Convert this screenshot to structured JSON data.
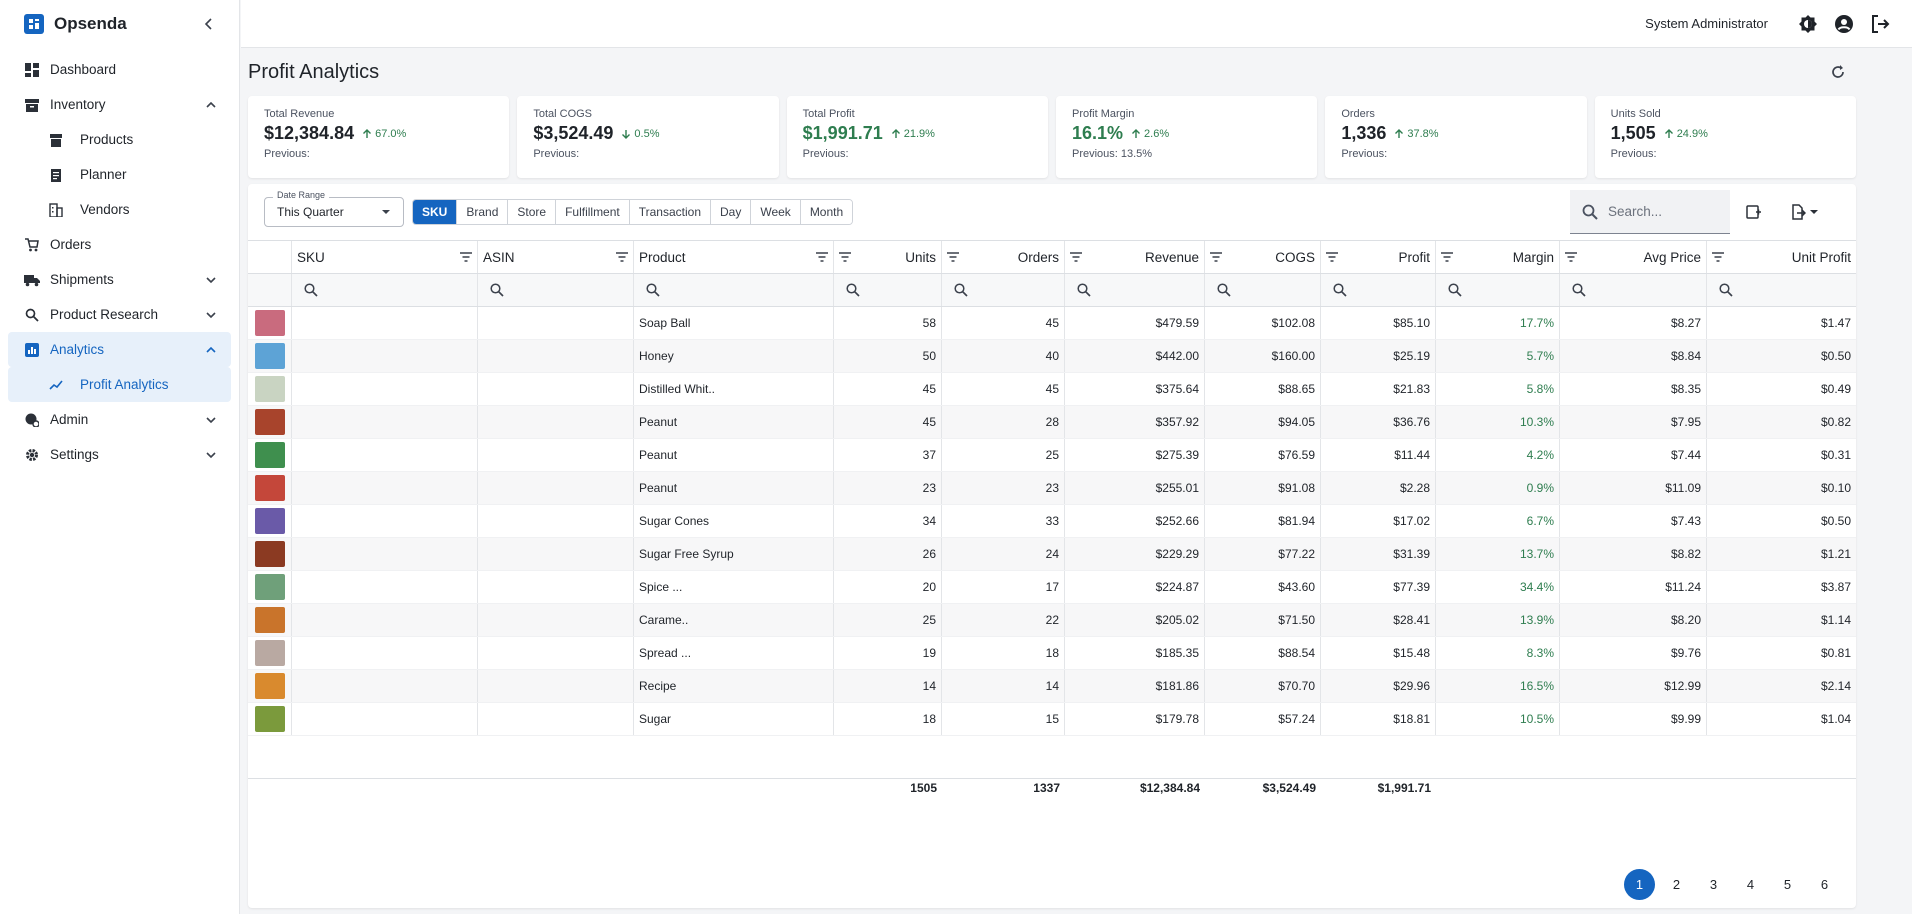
{
  "app": {
    "name": "Opsenda"
  },
  "sidebar": {
    "items": [
      {
        "label": "Dashboard",
        "icon": "dashboard-icon"
      },
      {
        "label": "Inventory",
        "icon": "inventory-icon",
        "expanded": true
      },
      {
        "label": "Products",
        "icon": "products-icon"
      },
      {
        "label": "Planner",
        "icon": "planner-icon"
      },
      {
        "label": "Vendors",
        "icon": "vendors-icon"
      },
      {
        "label": "Orders",
        "icon": "cart-icon"
      },
      {
        "label": "Shipments",
        "icon": "truck-icon"
      },
      {
        "label": "Product Research",
        "icon": "search-icon"
      },
      {
        "label": "Analytics",
        "icon": "analytics-icon",
        "expanded": true
      },
      {
        "label": "Profit Analytics",
        "icon": "trending-icon",
        "active": true
      },
      {
        "label": "Admin",
        "icon": "admin-icon"
      },
      {
        "label": "Settings",
        "icon": "gear-icon"
      }
    ]
  },
  "topbar": {
    "user": "System Administrator"
  },
  "page": {
    "title": "Profit Analytics"
  },
  "kpis": [
    {
      "label": "Total Revenue",
      "value": "$12,384.84",
      "delta": "67.0%",
      "direction": "up",
      "previous": "Previous:"
    },
    {
      "label": "Total COGS",
      "value": "$3,524.49",
      "delta": "0.5%",
      "direction": "down",
      "previous": "Previous:"
    },
    {
      "label": "Total Profit",
      "value": "$1,991.71",
      "delta": "21.9%",
      "direction": "up",
      "previous": "Previous:"
    },
    {
      "label": "Profit Margin",
      "value": "16.1%",
      "delta": "2.6%",
      "direction": "up",
      "previous": "Previous: 13.5%"
    },
    {
      "label": "Orders",
      "value": "1,336",
      "delta": "37.8%",
      "direction": "up",
      "previous": "Previous:"
    },
    {
      "label": "Units Sold",
      "value": "1,505",
      "delta": "24.9%",
      "direction": "up",
      "previous": "Previous:"
    }
  ],
  "toolbar": {
    "date_range_label": "Date Range",
    "date_range_value": "This Quarter",
    "groupings": [
      "SKU",
      "Brand",
      "Store",
      "Fulfillment",
      "Transaction",
      "Day",
      "Week",
      "Month"
    ],
    "active_grouping": "SKU",
    "search_placeholder": "Search..."
  },
  "table": {
    "columns": [
      "SKU",
      "ASIN",
      "Product",
      "Units",
      "Orders",
      "Revenue",
      "COGS",
      "Profit",
      "Margin",
      "Avg Price",
      "Unit Profit"
    ],
    "rows": [
      {
        "thumb": "#c96b7e",
        "sku": "",
        "asin": "",
        "product": "Soap Ball",
        "units": "58",
        "orders": "45",
        "revenue": "$479.59",
        "cogs": "$102.08",
        "profit": "$85.10",
        "margin": "17.7%",
        "avg_price": "$8.27",
        "unit_profit": "$1.47"
      },
      {
        "thumb": "#5da3d6",
        "sku": "",
        "asin": "",
        "product": "Honey",
        "units": "50",
        "orders": "40",
        "revenue": "$442.00",
        "cogs": "$160.00",
        "profit": "$25.19",
        "margin": "5.7%",
        "avg_price": "$8.84",
        "unit_profit": "$0.50"
      },
      {
        "thumb": "#c9d4c2",
        "sku": "",
        "asin": "",
        "product": "Distilled Whit..",
        "units": "45",
        "orders": "45",
        "revenue": "$375.64",
        "cogs": "$88.65",
        "profit": "$21.83",
        "margin": "5.8%",
        "avg_price": "$8.35",
        "unit_profit": "$0.49"
      },
      {
        "thumb": "#a8442c",
        "sku": "",
        "asin": "",
        "product": "Peanut",
        "units": "45",
        "orders": "28",
        "revenue": "$357.92",
        "cogs": "$94.05",
        "profit": "$36.76",
        "margin": "10.3%",
        "avg_price": "$7.95",
        "unit_profit": "$0.82"
      },
      {
        "thumb": "#3f8f4e",
        "sku": "",
        "asin": "",
        "product": "Peanut",
        "units": "37",
        "orders": "25",
        "revenue": "$275.39",
        "cogs": "$76.59",
        "profit": "$11.44",
        "margin": "4.2%",
        "avg_price": "$7.44",
        "unit_profit": "$0.31"
      },
      {
        "thumb": "#c4473a",
        "sku": "",
        "asin": "",
        "product": "Peanut",
        "units": "23",
        "orders": "23",
        "revenue": "$255.01",
        "cogs": "$91.08",
        "profit": "$2.28",
        "margin": "0.9%",
        "avg_price": "$11.09",
        "unit_profit": "$0.10"
      },
      {
        "thumb": "#6a5aa8",
        "sku": "",
        "asin": "",
        "product": "Sugar Cones",
        "units": "34",
        "orders": "33",
        "revenue": "$252.66",
        "cogs": "$81.94",
        "profit": "$17.02",
        "margin": "6.7%",
        "avg_price": "$7.43",
        "unit_profit": "$0.50"
      },
      {
        "thumb": "#8b3a22",
        "sku": "",
        "asin": "",
        "product": "Sugar Free Syrup",
        "units": "26",
        "orders": "24",
        "revenue": "$229.29",
        "cogs": "$77.22",
        "profit": "$31.39",
        "margin": "13.7%",
        "avg_price": "$8.82",
        "unit_profit": "$1.21"
      },
      {
        "thumb": "#6fa07a",
        "sku": "",
        "asin": "",
        "product": "Spice ...",
        "units": "20",
        "orders": "17",
        "revenue": "$224.87",
        "cogs": "$43.60",
        "profit": "$77.39",
        "margin": "34.4%",
        "avg_price": "$11.24",
        "unit_profit": "$3.87"
      },
      {
        "thumb": "#c9742b",
        "sku": "",
        "asin": "",
        "product": "Carame..",
        "units": "25",
        "orders": "22",
        "revenue": "$205.02",
        "cogs": "$71.50",
        "profit": "$28.41",
        "margin": "13.9%",
        "avg_price": "$8.20",
        "unit_profit": "$1.14"
      },
      {
        "thumb": "#b9a9a2",
        "sku": "",
        "asin": "",
        "product": "Spread ...",
        "units": "19",
        "orders": "18",
        "revenue": "$185.35",
        "cogs": "$88.54",
        "profit": "$15.48",
        "margin": "8.3%",
        "avg_price": "$9.76",
        "unit_profit": "$0.81"
      },
      {
        "thumb": "#d98a2e",
        "sku": "",
        "asin": "",
        "product": "Recipe",
        "units": "14",
        "orders": "14",
        "revenue": "$181.86",
        "cogs": "$70.70",
        "profit": "$29.96",
        "margin": "16.5%",
        "avg_price": "$12.99",
        "unit_profit": "$2.14"
      },
      {
        "thumb": "#7b9a3c",
        "sku": "",
        "asin": "",
        "product": "Sugar",
        "units": "18",
        "orders": "15",
        "revenue": "$179.78",
        "cogs": "$57.24",
        "profit": "$18.81",
        "margin": "10.5%",
        "avg_price": "$9.99",
        "unit_profit": "$1.04"
      }
    ],
    "totals": {
      "units": "1505",
      "orders": "1337",
      "revenue": "$12,384.84",
      "cogs": "$3,524.49",
      "profit": "$1,991.71"
    }
  },
  "pagination": {
    "pages": [
      "1",
      "2",
      "3",
      "4",
      "5",
      "6"
    ],
    "current": "1"
  },
  "colors": {
    "accent": "#1565c0",
    "positive": "#2e7d4f"
  }
}
